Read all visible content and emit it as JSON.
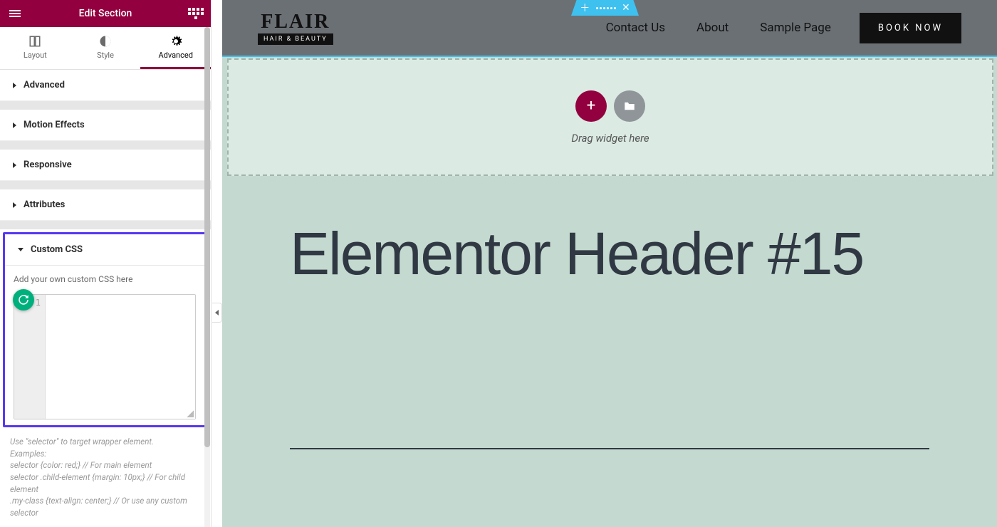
{
  "sidebar": {
    "title": "Edit Section",
    "tabs": {
      "layout": "Layout",
      "style": "Style",
      "advanced": "Advanced"
    },
    "sections": [
      "Advanced",
      "Motion Effects",
      "Responsive",
      "Attributes",
      "Custom CSS"
    ],
    "custom_css": {
      "hint": "Add your own custom CSS here",
      "gutter": "1",
      "value": "",
      "note1": "Use \"selector\" to target wrapper element.",
      "note2": "Examples:",
      "note3": "selector {color: red;} // For main element",
      "note4": "selector .child-element {margin: 10px;} // For child element",
      "note5": ".my-class {text-align: center;} // Or use any custom selector"
    }
  },
  "canvas": {
    "logo": {
      "top": "FLAIR",
      "bottom": "HAIR & BEAUTY"
    },
    "nav": [
      "Contact Us",
      "About",
      "Sample Page"
    ],
    "cta": "BOOK NOW",
    "drop_hint": "Drag widget here",
    "heading": "Elementor Header #15"
  }
}
